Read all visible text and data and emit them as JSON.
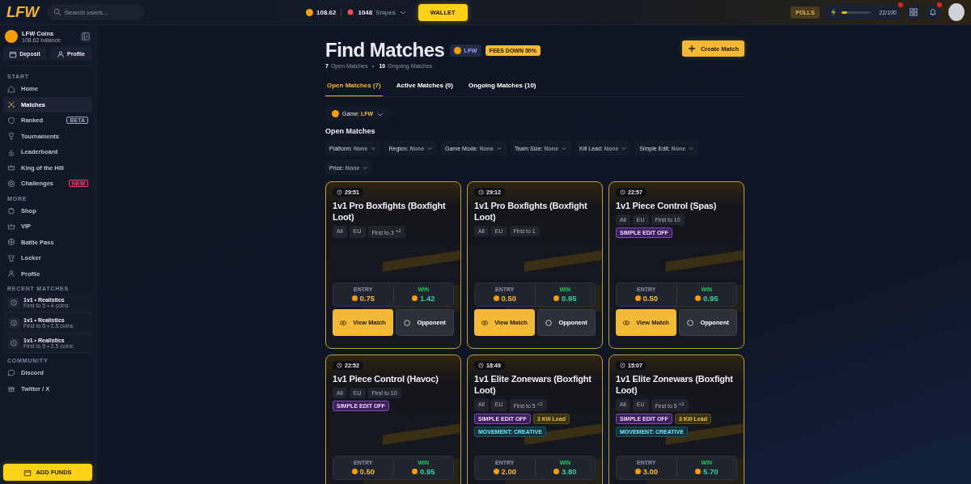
{
  "topbar": {
    "logo": "LFW",
    "search": {
      "placeholder": "Search users..."
    },
    "coins": "108.62",
    "snipes_count": "1048",
    "snipes_label": "Snipes",
    "wallet": "WALLET",
    "polls": "POLLS",
    "xp": {
      "level": 0.22,
      "reading": "22/100"
    }
  },
  "sidebar": {
    "account": {
      "name": "LFW Coins",
      "balance": "108.62 balance"
    },
    "buttons": [
      "Deposit",
      "Profile"
    ],
    "sections": [
      {
        "title": "START",
        "items": [
          {
            "label": "Home",
            "selected": false
          },
          {
            "label": "Matches",
            "selected": true
          },
          {
            "label": "Ranked",
            "selected": false,
            "tag": "BETA",
            "color": "#9aa2b3"
          },
          {
            "label": "Tournaments",
            "selected": false
          },
          {
            "label": "Leaderboard",
            "selected": false
          },
          {
            "label": "King of the Hill",
            "selected": false
          },
          {
            "label": "Challenges",
            "selected": false,
            "tag": "NEW",
            "color": "#ff3b6b"
          }
        ]
      },
      {
        "title": "MORE",
        "items": [
          {
            "label": "Shop",
            "selected": false
          },
          {
            "label": "VIP",
            "selected": false
          },
          {
            "label": "Battle Pass",
            "selected": false
          },
          {
            "label": "Locker",
            "selected": false
          },
          {
            "label": "Profile",
            "selected": false
          }
        ]
      }
    ],
    "recent_title": "RECENT MATCHES",
    "recent": [
      {
        "title": "1v1 • Realistics",
        "detail": "First to 5 • 4 coins"
      },
      {
        "title": "1v1 • Realistics",
        "detail": "First to 5 • 2.5 coins"
      },
      {
        "title": "1v1 • Realistics",
        "detail": "First to 5 • 2.5 coins"
      }
    ],
    "community_title": "COMMUNITY",
    "community": [
      {
        "label": "Discord"
      },
      {
        "label": "Twitter / X"
      }
    ],
    "add_funds": "ADD FUNDS"
  },
  "header": {
    "title": "Find Matches",
    "game_badge": "LFW",
    "promo": "FEES DOWN 50%",
    "open_count": "7",
    "open_label": "Open Matches",
    "ongoing_count": "10",
    "ongoing_label": "Ongoing Matches",
    "create": "Create Match"
  },
  "tabs": [
    {
      "label": "Open Matches (7)",
      "selected": true
    },
    {
      "label": "Active Matches (0)",
      "selected": false
    },
    {
      "label": "Ongoing Matches (10)",
      "selected": false
    }
  ],
  "game_filter": {
    "label": "Game:",
    "value": "LFW"
  },
  "section_title": "Open Matches",
  "filters": [
    {
      "label": "Platform:",
      "value": "None"
    },
    {
      "label": "Region:",
      "value": "None"
    },
    {
      "label": "Game Mode:",
      "value": "None"
    },
    {
      "label": "Team Size:",
      "value": "None"
    },
    {
      "label": "Kill Lead:",
      "value": "None"
    },
    {
      "label": "Simple Edit:",
      "value": "None"
    },
    {
      "label": "Price:",
      "value": "None"
    }
  ],
  "matches": [
    {
      "timer": "29:51",
      "title": "1v1 Pro Boxfights (Boxfight Loot)",
      "chips": [
        "All",
        "EU",
        "First to 3 $^{+2}$"
      ],
      "entry_label": "ENTRY",
      "entry": "0.75",
      "win_label": "WIN",
      "win": "1.42",
      "buttons": [
        "View Match",
        "Opponent"
      ]
    },
    {
      "timer": "29:12",
      "title": "1v1 Pro Boxfights (Boxfight Loot)",
      "chips": [
        "All",
        "EU",
        "First to 1"
      ],
      "entry_label": "ENTRY",
      "entry": "0.50",
      "win_label": "WIN",
      "win": "0.95",
      "buttons": [
        "View Match",
        "Opponent"
      ]
    },
    {
      "timer": "22:57",
      "title": "1v1 Piece Control (Spas)",
      "chips": [
        "All",
        "EU",
        "First to 10"
      ],
      "tags": [
        {
          "kind": "edit",
          "label": "SIMPLE EDIT OFF"
        }
      ],
      "entry_label": "ENTRY",
      "entry": "0.50",
      "win_label": "WIN",
      "win": "0.95",
      "buttons": [
        "View Match",
        "Opponent"
      ]
    },
    {
      "timer": "22:52",
      "title": "1v1 Piece Control (Havoc)",
      "chips": [
        "All",
        "EU",
        "First to 10"
      ],
      "tags": [
        {
          "kind": "edit",
          "label": "SIMPLE EDIT OFF"
        }
      ],
      "entry_label": "ENTRY",
      "entry": "0.50",
      "win_label": "WIN",
      "win": "0.95"
    },
    {
      "timer": "18:49",
      "title": "1v1 Elite Zonewars (Boxfight Loot)",
      "chips": [
        "All",
        "EU",
        "First to 5 $^{+2}$"
      ],
      "tags": [
        {
          "kind": "edit",
          "label": "SIMPLE EDIT OFF"
        },
        {
          "kind": "kill",
          "label": "2 Kill Lead"
        },
        {
          "kind": "movement",
          "label": "MOVEMENT: CREATIVE"
        }
      ],
      "entry_label": "ENTRY",
      "entry": "2.00",
      "win_label": "WIN",
      "win": "3.80"
    },
    {
      "timer": "15:07",
      "title": "1v1 Elite Zonewars (Boxfight Loot)",
      "chips": [
        "All",
        "EU",
        "First to 5 $^{+2}$"
      ],
      "tags": [
        {
          "kind": "edit",
          "label": "SIMPLE EDIT OFF"
        },
        {
          "kind": "kill",
          "label": "3 Kill Lead"
        },
        {
          "kind": "movement",
          "label": "MOVEMENT: CREATIVE"
        }
      ],
      "entry_label": "ENTRY",
      "entry": "3.00",
      "win_label": "WIN",
      "win": "5.70"
    }
  ]
}
